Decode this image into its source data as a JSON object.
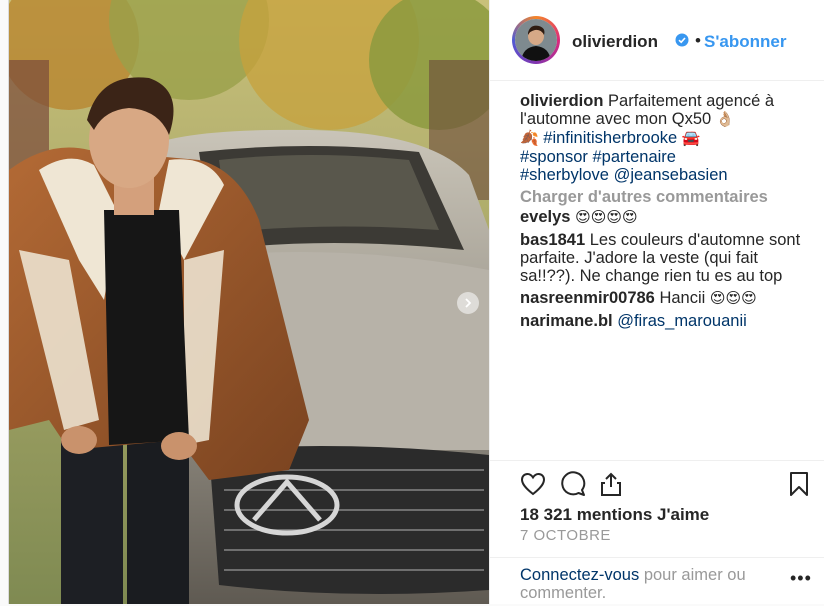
{
  "post": {
    "username": "olivierdion",
    "dot": "•",
    "follow_label": "S'abonner",
    "caption": {
      "user": "olivierdion",
      "text": "Parfaitement agencé à l'automne avec mon Qx50",
      "emoji_ok": "👌🏼",
      "emoji_leaf": "🍂",
      "tag1": "#infinitisherbrooke",
      "emoji_car": "🚘",
      "tag2": "#sponsor",
      "tag3": "#partenaire",
      "tag4": "#sherbylove",
      "mention": "@jeansebasien"
    },
    "load_more": "Charger d'autres commentaires",
    "comments": [
      {
        "user": "evelys",
        "text": "",
        "emoji": "😍😍😍😍"
      },
      {
        "user": "bas1841",
        "text": "Les couleurs d'automne sont parfaite. J'adore la veste (qui fait sa!!??). Ne change rien tu es au top",
        "emoji": ""
      },
      {
        "user": "nasreenmir00786",
        "text": "Hancii",
        "emoji": "😍😍😍"
      },
      {
        "user": "narimane.bl",
        "text": "@firas_marouanii",
        "emoji": ""
      }
    ],
    "likes": "18 321 mentions J'aime",
    "date": "7 OCTOBRE",
    "login_link": "Connectez-vous",
    "login_rest": " pour aimer ou commenter.",
    "more_options": "•••"
  },
  "icons": [
    "heart-icon",
    "comment-icon",
    "share-icon",
    "bookmark-icon",
    "verified-icon",
    "chevron-right-icon"
  ],
  "colors": {
    "link": "#3897f0",
    "tag": "#003569",
    "muted": "#999999",
    "border": "#efefef"
  }
}
